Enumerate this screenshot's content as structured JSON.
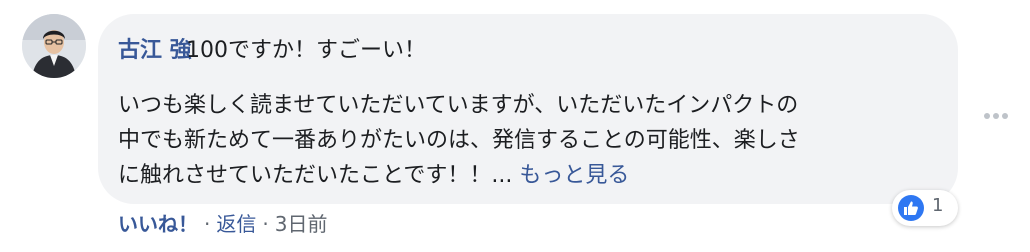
{
  "comment": {
    "author": "古江 強",
    "first_line": "100ですか！すごーい！",
    "body_line_1": "いつも楽しく読ませていただいていますが、いただいたインパクトの",
    "body_line_2": "中でも新ためて一番ありがたいのは、発信することの可能性、楽しさ",
    "body_line_3": "に触れさせていただいたことです！！... ",
    "see_more": "もっと見る"
  },
  "reaction": {
    "icon": "like-icon",
    "count": "1",
    "color": "#2e77f2"
  },
  "actions": {
    "like": "いいね！",
    "separator": "·",
    "reply": "返信",
    "time": "3日前"
  },
  "colors": {
    "link": "#385898",
    "text": "#1c1e21",
    "meta": "#606770",
    "bubble": "#f2f3f5"
  }
}
